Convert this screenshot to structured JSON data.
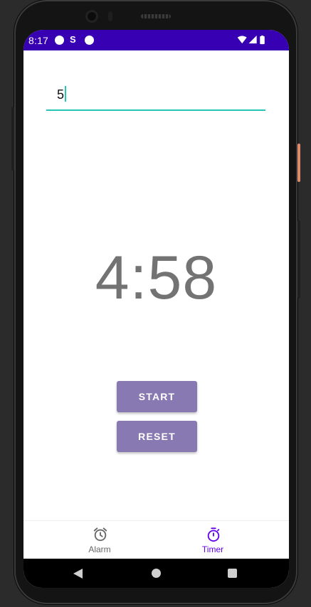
{
  "status_bar": {
    "time": "8:17",
    "sync_symbol": "S"
  },
  "timer_input": {
    "value": "5"
  },
  "countdown": {
    "display": "4:58"
  },
  "buttons": {
    "start_label": "START",
    "reset_label": "RESET"
  },
  "bottom_nav": {
    "items": [
      {
        "label": "Alarm",
        "icon": "alarm-clock-icon",
        "selected": false
      },
      {
        "label": "Timer",
        "icon": "stopwatch-icon",
        "selected": true
      }
    ]
  },
  "colors": {
    "status_bar": "#3700b3",
    "accent_teal": "#26c6b4",
    "button": "#8879b3",
    "nav_selected": "#6200ee",
    "nav_unselected": "#666666",
    "countdown_text": "#737373"
  }
}
